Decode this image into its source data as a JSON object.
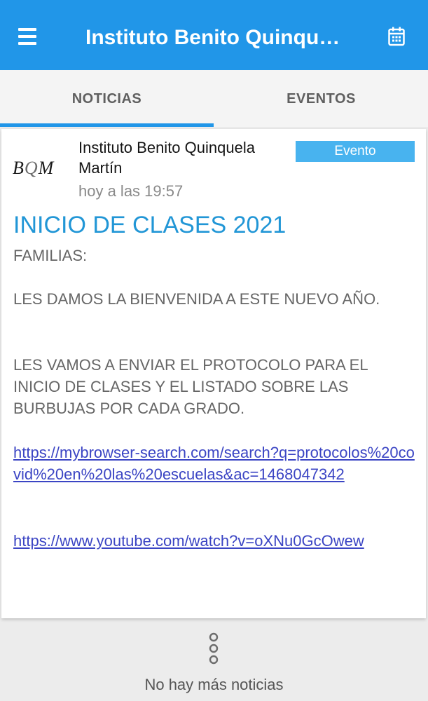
{
  "appbar": {
    "title": "Instituto Benito Quinqu…",
    "menu_icon": "hamburger-menu-icon",
    "calendar_icon": "calendar-icon",
    "color": "#2196e8"
  },
  "tabs": [
    {
      "label": "NOTICIAS",
      "active": true
    },
    {
      "label": "EVENTOS",
      "active": false
    }
  ],
  "post": {
    "logo_text": "BQM",
    "author": "Instituto Benito Quinquela Martín",
    "timestamp": "hoy a las 19:57",
    "badge": "Evento",
    "title": "INICIO DE CLASES 2021",
    "paragraphs": [
      "FAMILIAS:",
      "LES DAMOS LA BIENVENIDA A ESTE NUEVO AÑO.",
      "LES VAMOS A ENVIAR EL PROTOCOLO PARA EL INICIO DE CLASES Y EL LISTADO SOBRE LAS BURBUJAS POR CADA GRADO."
    ],
    "links": [
      "https://mybrowser-search.com/search?q=protocolos%20covid%20en%20las%20escuelas&ac=1468047342",
      "https://www.youtube.com/watch?v=oXNu0GcOwew"
    ]
  },
  "footer": {
    "more_icon": "vertical-dots-icon",
    "message": "No hay más noticias"
  }
}
